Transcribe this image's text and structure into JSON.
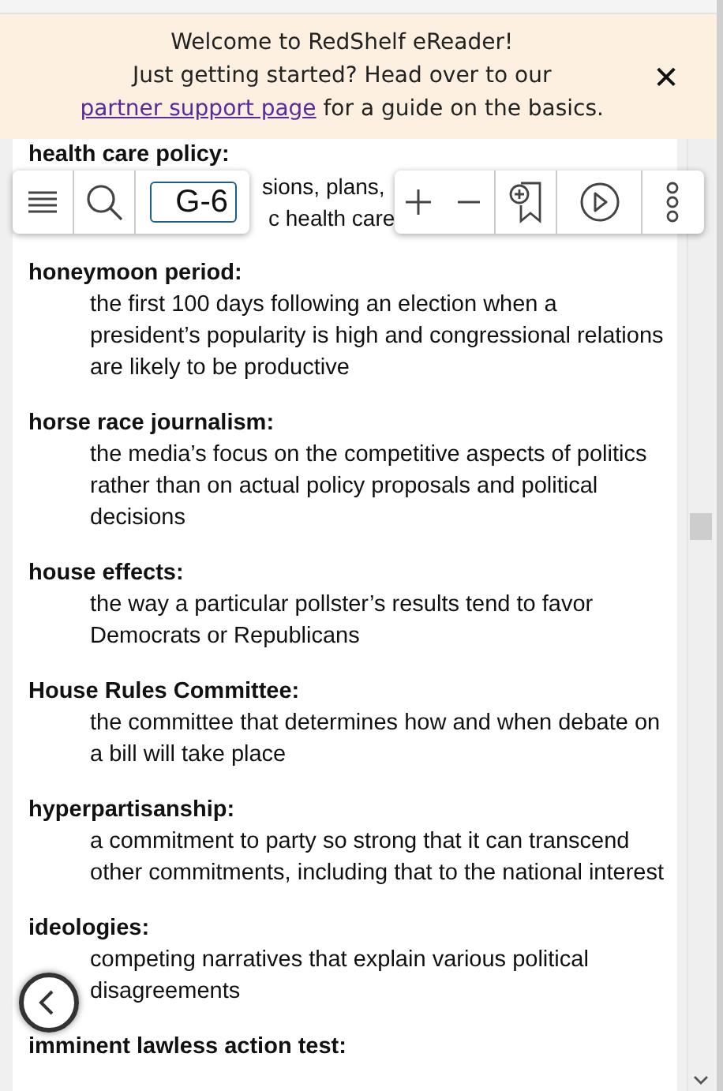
{
  "banner": {
    "title": "Welcome to RedShelf eReader!",
    "text_before": "Just getting started? Head over to our",
    "link": "partner support page",
    "text_after": "for a guide on the basics.",
    "close": "✕"
  },
  "toolbar": {
    "page_field": "G-6"
  },
  "partial_entry": {
    "term": "health care policy:",
    "fragments": [
      "sions, plans,",
      "c health care"
    ]
  },
  "entries": [
    {
      "term": "honeymoon period:",
      "definition": "the first 100 days following an election when a president’s popularity is high and congressional relations are likely to be productive"
    },
    {
      "term": "horse race journalism:",
      "definition": "the media’s focus on the competitive aspects of politics rather than on actual policy proposals and political decisions"
    },
    {
      "term": "house effects:",
      "definition": "the way a particular pollster’s results tend to favor Democrats or Republicans"
    },
    {
      "term": "House Rules Committee:",
      "definition": "the committee that determines how and when debate on a bill will take place"
    },
    {
      "term": "hyperpartisanship:",
      "definition": "a commitment to party so strong that it can transcend other commitments, including that to the national interest"
    },
    {
      "term": "ideologies:",
      "definition": "competing narratives that explain various political disagreements"
    },
    {
      "term": "imminent lawless action test:"
    }
  ]
}
